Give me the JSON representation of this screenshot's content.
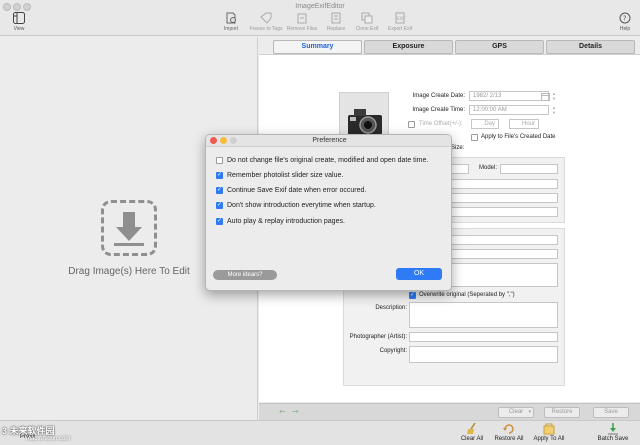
{
  "window": {
    "title": "ImageExifEditor"
  },
  "toolbar": {
    "view": "View",
    "import": "Import",
    "freeze_tags": "Freeze to Tags",
    "remove_files": "Remove Files",
    "replace": "Replace",
    "clone_exif": "Clone Exif",
    "export_exif": "Export Exif",
    "help": "Help"
  },
  "left": {
    "drop_label": "Drag Image(s) Here To Edit"
  },
  "tabs": [
    "Summary",
    "Exposure",
    "GPS",
    "Details"
  ],
  "summary": {
    "image_create_date_label": "Image Create Date:",
    "image_create_date_value": "1982/ 2/13",
    "image_create_time_label": "Image Create Time:",
    "image_create_time_value": "12:00:00 AM",
    "time_offset_label": "Time Offset(+/-):",
    "day_placeholder": "Day",
    "hour_placeholder": "Hour",
    "apply_created_date_label": "Apply to File's Created Date",
    "size_label": "Size:",
    "model_label": "Model:",
    "overwrite_label": "Overwrite original (Seperated by \",\")",
    "description_label": "Description:",
    "photographer_label": "Photographer (Artist):",
    "copyright_label": "Copyright:"
  },
  "bottom_controls": {
    "clear": "Clear",
    "restore": "Restore",
    "save": "Save"
  },
  "bottom_bar": {
    "clear_all": "Clear All",
    "restore_all": "Restore All",
    "apply_to_all": "Apply To All",
    "batch_save": "Batch Save",
    "prefix": "Prefix"
  },
  "watermark": {
    "brand": "3 未来软件园",
    "url": "mac.orsoon.com"
  },
  "dialog": {
    "title": "Preference",
    "options": [
      {
        "label": "Do not change file's original create, modified and open date time.",
        "checked": false
      },
      {
        "label": "Remember photolist slider size value.",
        "checked": true
      },
      {
        "label": "Continue Save Exif date when error occured.",
        "checked": true
      },
      {
        "label": "Don't show introduction everytime when startup.",
        "checked": true
      },
      {
        "label": "Auto play & replay introduction pages.",
        "checked": true
      }
    ],
    "more_button": "More idears?",
    "ok_button": "OK"
  },
  "colors": {
    "accent": "#2f7bf5",
    "active_tab": "#1a63d6",
    "close": "#ee5a52",
    "minimize": "#f4bd3d",
    "zoom_inactive": "#d0d0d0"
  }
}
